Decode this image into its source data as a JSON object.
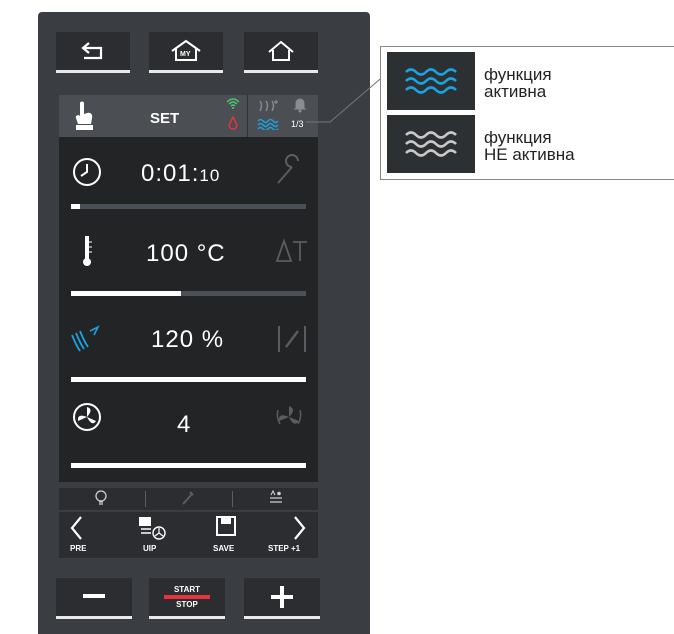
{
  "top_nav": {
    "buttons": [
      {
        "name": "back",
        "icon": "back-arrow-icon"
      },
      {
        "name": "my-home",
        "icon": "my-home-icon",
        "label": "MY"
      },
      {
        "name": "home",
        "icon": "home-icon"
      }
    ]
  },
  "header": {
    "mode_label": "SET",
    "page_indicator": "1/3"
  },
  "params": {
    "time": {
      "hours_minutes": "0:01:",
      "seconds": "10",
      "progress_fraction": 0.04
    },
    "temperature": {
      "value": "100 °C",
      "progress_fraction": 0.47
    },
    "humidity": {
      "value": "120 %",
      "progress_fraction": 1.0
    },
    "fan": {
      "value": "4",
      "progress_fraction": 1.0
    }
  },
  "bottom_nav": {
    "pre": "PRE",
    "uip": "UIP",
    "save": "SAVE",
    "step": "STEP +1"
  },
  "controls": {
    "start_label": "START",
    "stop_label": "STOP"
  },
  "legend": {
    "active": [
      "функция",
      "активна"
    ],
    "inactive": [
      "функция",
      "НЕ активна"
    ]
  },
  "colors": {
    "active_blue": "#1aa3e0",
    "inactive_gray": "#c8c8c8",
    "start_stop_red": "#e5333f",
    "wifi_green": "#48c774"
  }
}
